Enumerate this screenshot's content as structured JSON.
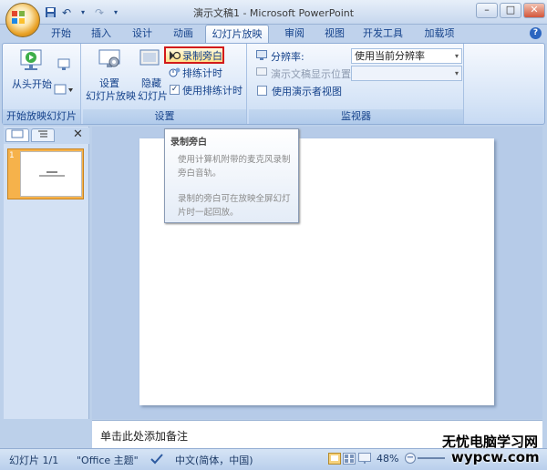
{
  "window": {
    "title": "演示文稿1 - Microsoft PowerPoint",
    "minimize": "–",
    "maximize": "□",
    "close": "✕"
  },
  "tabs": [
    {
      "label": "开始"
    },
    {
      "label": "插入"
    },
    {
      "label": "设计"
    },
    {
      "label": "动画"
    },
    {
      "label": "幻灯片放映",
      "active": true
    },
    {
      "label": "审阅"
    },
    {
      "label": "视图"
    },
    {
      "label": "开发工具"
    },
    {
      "label": "加载项"
    }
  ],
  "ribbon": {
    "group_start": {
      "label": "开始放映幻灯片",
      "from_start": "从头开始"
    },
    "group_setup": {
      "label": "设置",
      "setup_show_line1": "设置",
      "setup_show_line2": "幻灯片放映",
      "hide_line1": "隐藏",
      "hide_line2": "幻灯片",
      "record_narration": "录制旁白",
      "rehearse_timings": "排练计时",
      "use_rehearsed": "使用排练计时",
      "use_rehearsed_checked": true
    },
    "group_monitors": {
      "label": "监视器",
      "resolution_label": "分辨率:",
      "resolution_value": "使用当前分辨率",
      "show_on_label": "演示文稿显示位置:",
      "show_on_value": "",
      "presenter_view": "使用演示者视图",
      "presenter_view_checked": false
    }
  },
  "tooltip": {
    "title": "录制旁白",
    "line1": "使用计算机附带的麦克风录制旁白音轨。",
    "line2": "录制的旁白可在放映全屏幻灯片时一起回放。"
  },
  "left_pane": {
    "slide_number": "1",
    "close": "✕"
  },
  "notes": {
    "placeholder": "单击此处添加备注"
  },
  "status": {
    "slide": "幻灯片 1/1",
    "theme": "\"Office 主题\"",
    "language": "中文(简体，中国)",
    "zoom": "48%"
  },
  "watermark": {
    "line1": "无忧电脑学习网",
    "line2": "wypcw.com"
  },
  "colors": {
    "ribbon_bg": "#d7e5f7",
    "highlight": "#d21a1a",
    "thumb_selected": "#f6b24b"
  }
}
